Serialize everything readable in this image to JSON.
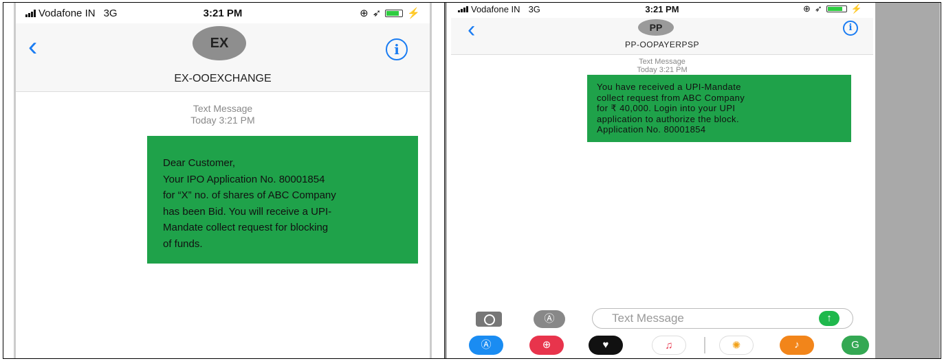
{
  "left_phone": {
    "status": {
      "carrier": "Vodafone IN",
      "network": "3G",
      "time": "3:21 PM"
    },
    "contact": {
      "initials": "EX",
      "name": "EX-OOEXCHANGE"
    },
    "meta": {
      "label": "Text Message",
      "time": "Today 3:21 PM"
    },
    "message": [
      "Dear Customer,",
      "Your IPO Application No. 80001854",
      "for “X” no. of shares of ABC Company",
      "has been Bid. You will receive a UPI-",
      "Mandate collect request for blocking",
      "of funds."
    ]
  },
  "right_phone": {
    "status": {
      "carrier": "Vodafone IN",
      "network": "3G",
      "time": "3:21 PM"
    },
    "contact": {
      "initials": "PP",
      "name": "PP-OOPAYERPSP"
    },
    "meta": {
      "label": "Text Message",
      "time": "Today 3:21 PM"
    },
    "message": [
      "You have received a UPI-Mandate",
      "collect request from ABC Company",
      "for ₹ 40,000. Login into your UPI",
      "application to authorize the block.",
      "Application No. 80001854"
    ],
    "composer": {
      "placeholder": "Text Message"
    }
  },
  "colors": {
    "bubble": "#1fa24a",
    "accent": "#1a7cf2",
    "send": "#1fb84c"
  },
  "icons": [
    "back-chevron-icon",
    "info-icon",
    "camera-icon",
    "app-store-icon",
    "send-arrow-icon",
    "search-globe-icon",
    "heart-record-icon",
    "music-note-icon",
    "photos-pinwheel-icon",
    "guitar-icon",
    "maps-icon"
  ]
}
